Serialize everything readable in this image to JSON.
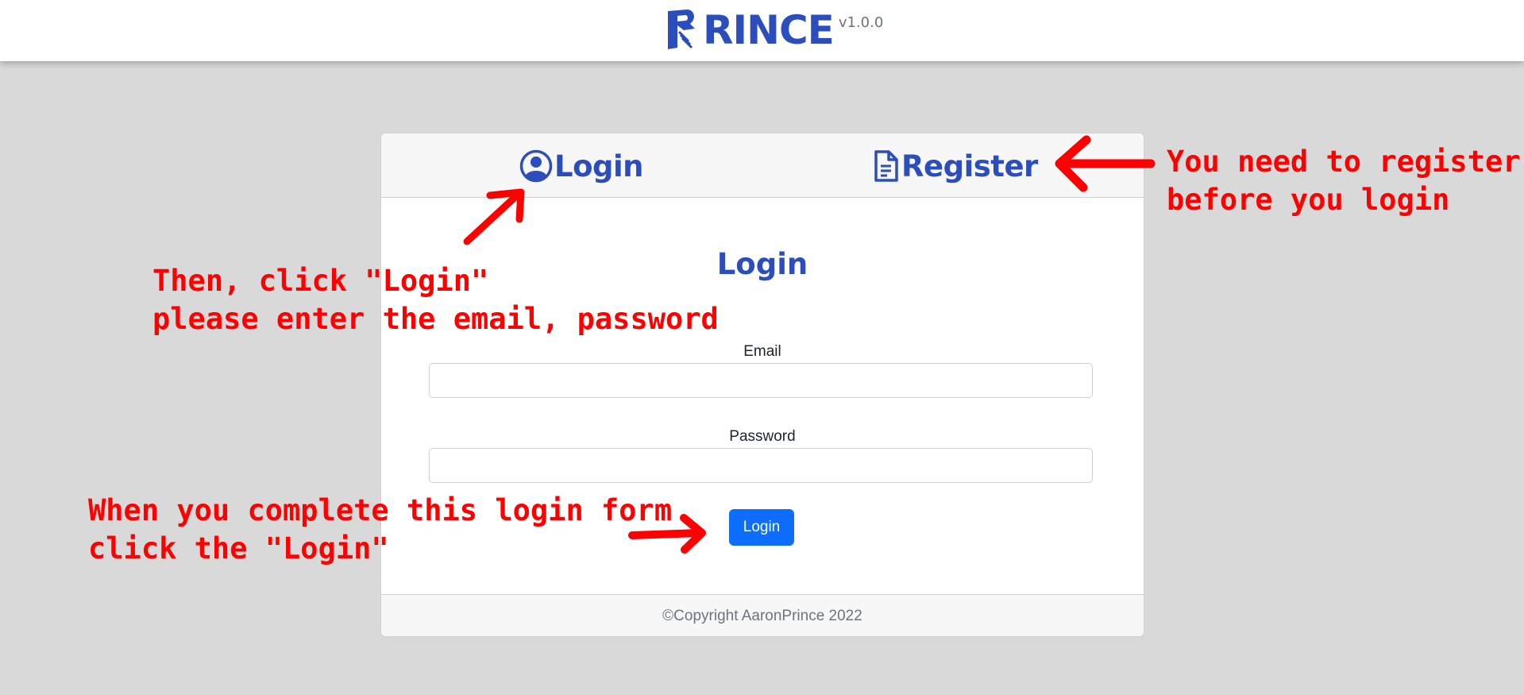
{
  "header": {
    "brand_name": "RINCE",
    "version": "v1.0.0",
    "logo_icon": "rince-logo-icon"
  },
  "tabs": {
    "login": {
      "label": "Login",
      "icon": "user-circle-icon"
    },
    "register": {
      "label": "Register",
      "icon": "document-icon"
    }
  },
  "form": {
    "title": "Login",
    "email_label": "Email",
    "email_value": "",
    "password_label": "Password",
    "password_value": "",
    "submit_label": "Login"
  },
  "footer": {
    "text": "©Copyright AaronPrince 2022"
  },
  "annotations": {
    "register_note": "You need to register\nbefore you login",
    "login_note": "Then, click \"Login\"\nplease enter the email, password",
    "submit_note": "When you complete this login form\nclick the \"Login\""
  },
  "colors": {
    "brand": "#2c4ebd",
    "primary_button": "#0d6efd",
    "annotation": "#ff0000",
    "background": "#d9d9d9"
  }
}
